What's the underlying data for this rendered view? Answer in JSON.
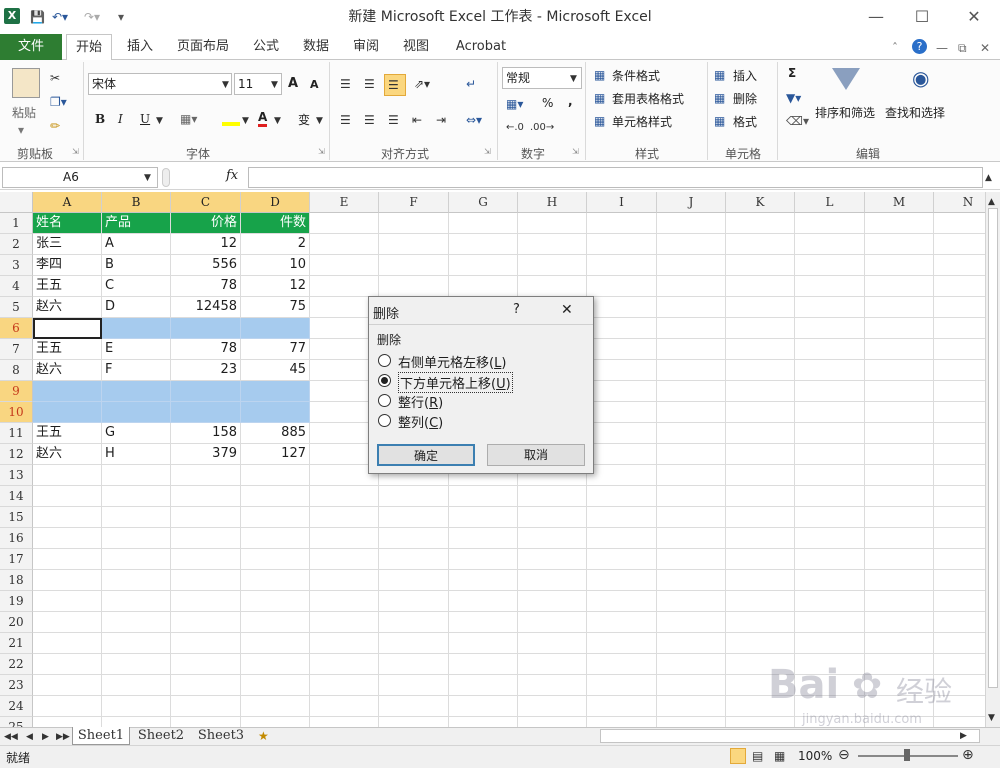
{
  "window": {
    "title": "新建 Microsoft Excel 工作表 - Microsoft Excel",
    "icon": "excel-icon"
  },
  "tabs": [
    "文件",
    "开始",
    "插入",
    "页面布局",
    "公式",
    "数据",
    "审阅",
    "视图",
    "Acrobat"
  ],
  "active_tab": "开始",
  "ribbon": {
    "groups": [
      "剪贴板",
      "字体",
      "对齐方式",
      "数字",
      "样式",
      "单元格",
      "编辑"
    ],
    "paste_label": "粘贴",
    "font_name": "宋体",
    "font_size": "11",
    "number_format": "常规",
    "style_items": [
      "条件格式",
      "套用表格格式",
      "单元格样式"
    ],
    "cell_items": [
      "插入",
      "删除",
      "格式"
    ],
    "sort_filter": "排序和筛选",
    "find_select": "查找和选择",
    "bold": "B",
    "italic": "I",
    "underline": "U",
    "font_color_letter": "A",
    "percent": "%",
    "comma": ",",
    "sigma": "Σ",
    "wen": "变",
    "font_grow": "A",
    "font_shrink": "A"
  },
  "formula_bar": {
    "name_box": "A6",
    "fx": "fx",
    "value": ""
  },
  "columns": [
    "A",
    "B",
    "C",
    "D",
    "E",
    "F",
    "G",
    "H",
    "I",
    "J",
    "K",
    "L",
    "M",
    "N"
  ],
  "rows": [
    "1",
    "2",
    "3",
    "4",
    "5",
    "6",
    "7",
    "8",
    "9",
    "10",
    "11",
    "12",
    "13",
    "14",
    "15",
    "16",
    "17",
    "18",
    "19",
    "20",
    "21",
    "22",
    "23",
    "24",
    "25"
  ],
  "table": {
    "headers": [
      "姓名",
      "产品",
      "价格",
      "件数"
    ],
    "rows": [
      {
        "row": 2,
        "cells": [
          "张三",
          "A",
          "12",
          "2"
        ]
      },
      {
        "row": 3,
        "cells": [
          "李四",
          "B",
          "556",
          "10"
        ]
      },
      {
        "row": 4,
        "cells": [
          "王五",
          "C",
          "78",
          "12"
        ]
      },
      {
        "row": 5,
        "cells": [
          "赵六",
          "D",
          "12458",
          "75"
        ]
      },
      {
        "row": 7,
        "cells": [
          "王五",
          "E",
          "78",
          "77"
        ]
      },
      {
        "row": 8,
        "cells": [
          "赵六",
          "F",
          "23",
          "45"
        ]
      },
      {
        "row": 11,
        "cells": [
          "王五",
          "G",
          "158",
          "885"
        ]
      },
      {
        "row": 12,
        "cells": [
          "赵六",
          "H",
          "379",
          "127"
        ]
      }
    ],
    "selected_rows": [
      "6",
      "9",
      "10"
    ],
    "active_cell": "A6"
  },
  "sheets": [
    "Sheet1",
    "Sheet2",
    "Sheet3"
  ],
  "active_sheet": "Sheet1",
  "status": {
    "ready": "就绪",
    "zoom": "100%"
  },
  "dialog": {
    "title": "删除",
    "help": "?",
    "close": "✕",
    "group_label": "删除",
    "options": [
      {
        "label": "右侧单元格左移",
        "key": "L",
        "selected": false
      },
      {
        "label": "下方单元格上移",
        "key": "U",
        "selected": true
      },
      {
        "label": "整行",
        "key": "R",
        "selected": false
      },
      {
        "label": "整列",
        "key": "C",
        "selected": false
      }
    ],
    "ok": "确定",
    "cancel": "取消"
  },
  "watermark": {
    "brand": "Bai",
    "brand2": "经验",
    "url": "jingyan.baidu.com"
  },
  "colors": {
    "file_tab": "#2e7d32",
    "header_fill": "#17a34a",
    "selection": "#a6cbee",
    "col_hdr_sel": "#f9d681"
  }
}
